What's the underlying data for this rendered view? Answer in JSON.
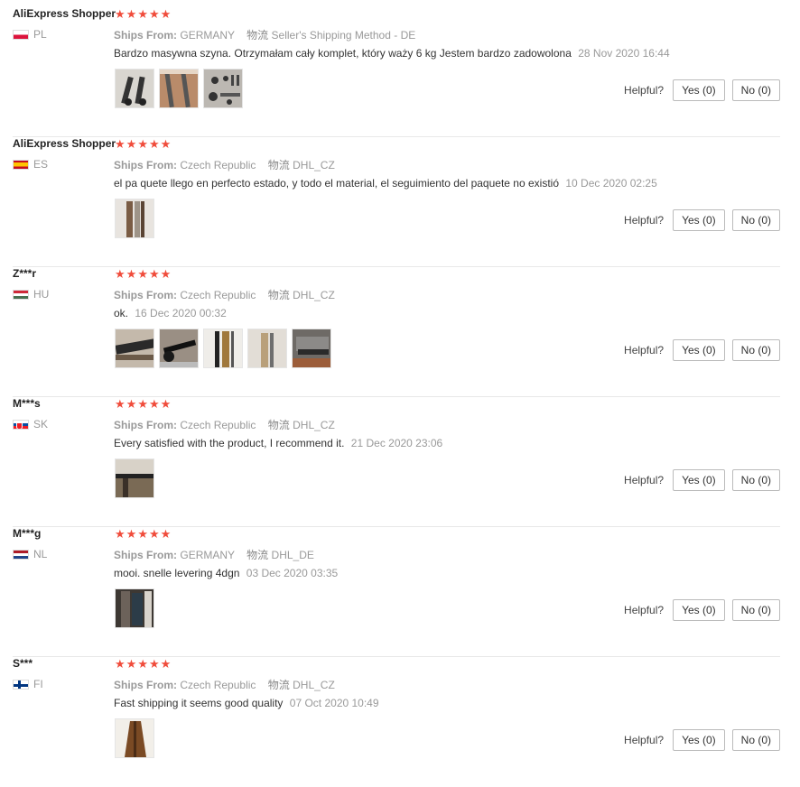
{
  "labels": {
    "ships_from": "Ships From:",
    "logistics": "物流",
    "helpful": "Helpful?",
    "yes": "Yes (0)",
    "no": "No (0)"
  },
  "reviews": [
    {
      "user": "AliExpress Shopper",
      "country": "PL",
      "rating": 5,
      "ships_from": "GERMANY",
      "logistics": "Seller's Shipping Method - DE",
      "comment": "Bardzo masywna szyna. Otrzymałam cały komplet, który waży 6 kg Jestem bardzo zadowolona",
      "date": "28 Nov 2020 16:44",
      "photos": 3
    },
    {
      "user": "AliExpress Shopper",
      "country": "ES",
      "rating": 5,
      "ships_from": "Czech Republic",
      "logistics": "DHL_CZ",
      "comment": "el pa quete llego en perfecto estado, y todo el material, el seguimiento del paquete no existió",
      "date": "10 Dec 2020 02:25",
      "photos": 1
    },
    {
      "user": "Z***r",
      "country": "HU",
      "rating": 5,
      "ships_from": "Czech Republic",
      "logistics": "DHL_CZ",
      "comment": "ok.",
      "date": "16 Dec 2020 00:32",
      "photos": 5
    },
    {
      "user": "M***s",
      "country": "SK",
      "rating": 5,
      "ships_from": "Czech Republic",
      "logistics": "DHL_CZ",
      "comment": "Every satisfied with the product, I recommend it.",
      "date": "21 Dec 2020 23:06",
      "photos": 1
    },
    {
      "user": "M***g",
      "country": "NL",
      "rating": 5,
      "ships_from": "GERMANY",
      "logistics": "DHL_DE",
      "comment": "mooi. snelle levering 4dgn",
      "date": "03 Dec 2020 03:35",
      "photos": 1
    },
    {
      "user": "S***",
      "country": "FI",
      "rating": 5,
      "ships_from": "Czech Republic",
      "logistics": "DHL_CZ",
      "comment": "Fast shipping it seems good quality",
      "date": "07 Oct 2020 10:49",
      "photos": 1
    }
  ]
}
